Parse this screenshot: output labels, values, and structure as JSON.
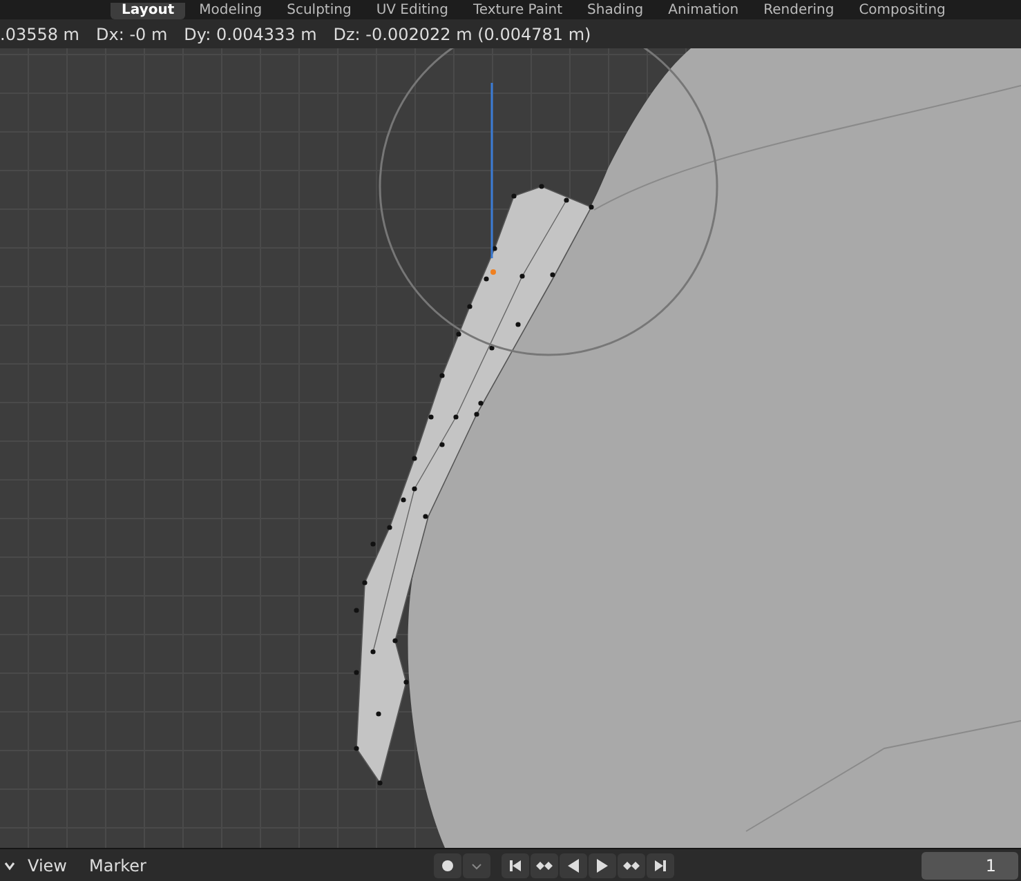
{
  "workspace_tabs": [
    {
      "label": "Layout",
      "selected": true
    },
    {
      "label": "Modeling",
      "selected": false
    },
    {
      "label": "Sculpting",
      "selected": false
    },
    {
      "label": "UV Editing",
      "selected": false
    },
    {
      "label": "Texture Paint",
      "selected": false
    },
    {
      "label": "Shading",
      "selected": false
    },
    {
      "label": "Animation",
      "selected": false
    },
    {
      "label": "Rendering",
      "selected": false
    },
    {
      "label": "Compositing",
      "selected": false
    }
  ],
  "transform_header": [
    ".03558 m",
    "Dx: -0 m",
    "Dy: 0.004333 m",
    "Dz: -0.002022 m (0.004781 m)"
  ],
  "timeline": {
    "menus": [
      "View",
      "Marker"
    ],
    "current_frame": "1"
  }
}
